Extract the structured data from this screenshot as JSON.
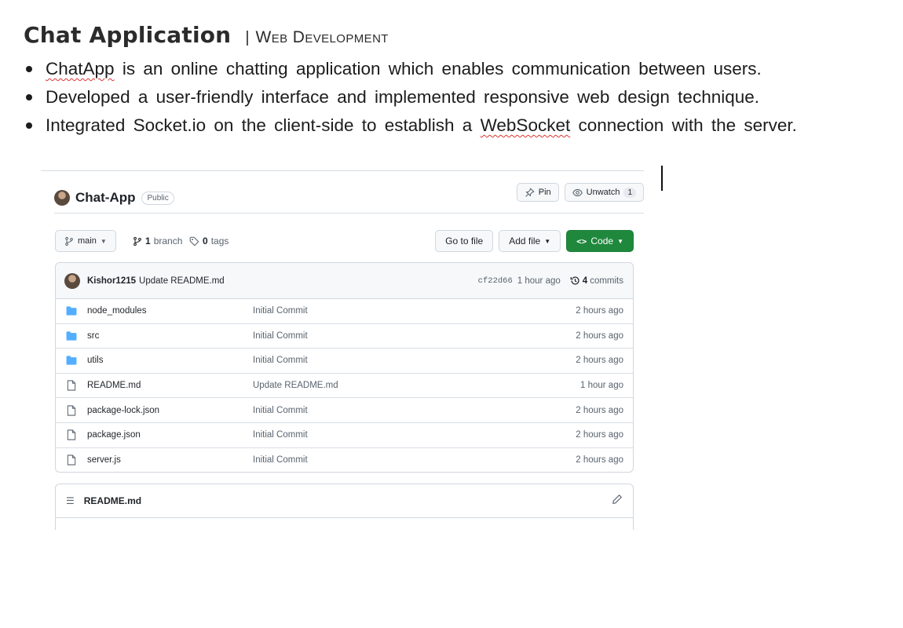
{
  "document": {
    "title": "Chat Application",
    "separator": "|",
    "subtitle": "Web Development",
    "bullets": [
      {
        "underlined": "ChatApp",
        "rest": " is an online chatting application which enables communication between users."
      },
      {
        "text": "Developed a user-friendly interface and implemented responsive web design technique."
      },
      {
        "before": "Integrated Socket.io on the client-side to establish a ",
        "underlined": "WebSocket",
        "after": " connection with the server."
      }
    ]
  },
  "repo": {
    "name": "Chat-App",
    "visibility": "Public",
    "pin_label": "Pin",
    "watch_label": "Unwatch",
    "watch_count": "1",
    "branch": "main",
    "branch_count": "1",
    "branch_word": "branch",
    "tag_count": "0",
    "tag_word": "tags",
    "go_to_file": "Go to file",
    "add_file": "Add file",
    "code": "Code",
    "code_glyph": "<>",
    "commit": {
      "user": "Kishor1215",
      "message": "Update README.md",
      "sha": "cf22d66",
      "time": "1 hour ago",
      "count": "4",
      "count_word": "commits"
    },
    "files": [
      {
        "name": "node_modules",
        "type": "folder",
        "commit": "Initial Commit",
        "time": "2 hours ago"
      },
      {
        "name": "src",
        "type": "folder",
        "commit": "Initial Commit",
        "time": "2 hours ago"
      },
      {
        "name": "utils",
        "type": "folder",
        "commit": "Initial Commit",
        "time": "2 hours ago"
      },
      {
        "name": "README.md",
        "type": "file",
        "commit": "Update README.md",
        "time": "1 hour ago"
      },
      {
        "name": "package-lock.json",
        "type": "file",
        "commit": "Initial Commit",
        "time": "2 hours ago"
      },
      {
        "name": "package.json",
        "type": "file",
        "commit": "Initial Commit",
        "time": "2 hours ago"
      },
      {
        "name": "server.js",
        "type": "file",
        "commit": "Initial Commit",
        "time": "2 hours ago"
      }
    ],
    "readme_title": "README.md"
  },
  "colors": {
    "folder": "#54aeff",
    "file_outline": "#59636e",
    "code_button": "#1f883d"
  },
  "icons": {
    "pin": "pin-icon",
    "watch": "eye-icon",
    "branch": "git-branch-icon",
    "tag": "tag-icon",
    "history": "history-icon",
    "folder": "folder-icon",
    "file": "file-icon",
    "list": "list-icon",
    "edit": "pencil-icon"
  }
}
